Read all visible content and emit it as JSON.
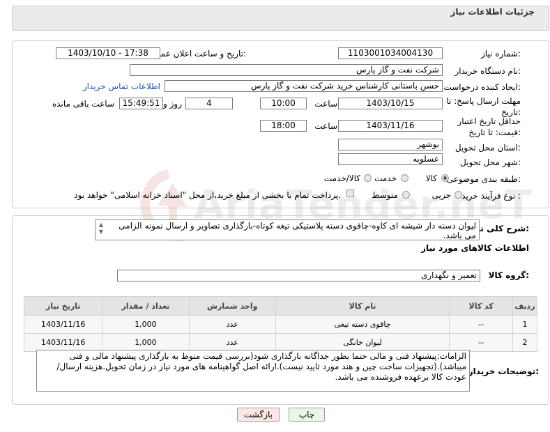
{
  "header": {
    "title": "جزئیات اطلاعات نیاز"
  },
  "form": {
    "need_number_label": "شماره نیاز:",
    "need_number": "1103001034004130",
    "announce_label": "تاریخ و ساعت اعلان عمومی:",
    "announce_value": "1403/10/10 - 17:38",
    "buyer_label": "نام دستگاه خریدار:",
    "buyer_value": "شرکت نفت و گاز پارس",
    "creator_label": "ایجاد کننده درخواست:",
    "creator_value": "حسن باستانی کارشناس خرید شرکت نفت و گاز پارس",
    "contact_link": "اطلاعات تماس خریدار",
    "deadline_label": "مهلت ارسال پاسخ: تا تاریخ:",
    "deadline_date": "1403/10/15",
    "time_word": "ساعت",
    "deadline_time": "10:00",
    "days_value": "4",
    "days_word": "روز و",
    "remaining_time": "15:49:51",
    "remaining_word": "ساعت باقی مانده",
    "validity_label": "حداقل تاریخ اعتبار قیمت: تا تاریخ:",
    "validity_date": "1403/11/16",
    "validity_time": "18:00",
    "province_label": "استان محل تحویل:",
    "province_value": "بوشهر",
    "city_label": "شهر محل تحویل:",
    "city_value": "عسلویه",
    "category_label": "طبقه بندی موضوعی:",
    "category_options": [
      "کالا",
      "خدمت",
      "کالا/خدمت"
    ],
    "process_label": "نوع فرآیند خرید :",
    "process_options": [
      "جزیی",
      "متوسط"
    ],
    "payment_note": "پرداخت تمام یا بخشی از مبلغ خرید،از محل \"اسناد خزانه اسلامی\" خواهد بود."
  },
  "description": {
    "label": "شرح کلی نیاز:",
    "text": "لیوان دسته دار شیشه ای کاوه-چاقوی دسته پلاستیکی تیغه کوتاه-بارگذاری تصاویر و ارسال نمونه الزامی می باشد."
  },
  "goods": {
    "section_title": "اطلاعات کالاهای مورد نیاز",
    "group_label": "گروه کالا:",
    "group_value": "تعمیر و نگهداری",
    "columns": [
      "ردیف",
      "کد کالا",
      "نام کالا",
      "واحد شمارش",
      "تعداد / مقدار",
      "تاریخ نیاز"
    ],
    "rows": [
      [
        "1",
        "--",
        "چاقوی دسته تیغی",
        "عدد",
        "1,000",
        "1403/11/16"
      ],
      [
        "2",
        "--",
        "لیوان خانگی",
        "عدد",
        "1,000",
        "1403/11/16"
      ]
    ]
  },
  "buyer_notes": {
    "label": "توضیحات خریدار:",
    "text": "الزامات:پیشنهاد فنی و مالی حتما  بطور جداگانه بارگذاری شود(بررسی قیمت منوط به بارگذاری پیشنهاد مالی و فنی میباشد).(تجهیزات ساخت چین و هند مورد تایید نیست).ارائه اصل گواهینامه های مورد نیاز در زمان تحویل.هزینه ارسال/عودت کالا برعهده فروشنده می باشد."
  },
  "buttons": {
    "print": "چاپ",
    "back": "بازگشت"
  },
  "watermark": {
    "text": "AriaTender.neT"
  },
  "colors": {
    "header_bg": "#ebebeb",
    "link": "#1a4fb5",
    "table_header": "#e4e4e4",
    "back_button": "#fde6e6"
  }
}
